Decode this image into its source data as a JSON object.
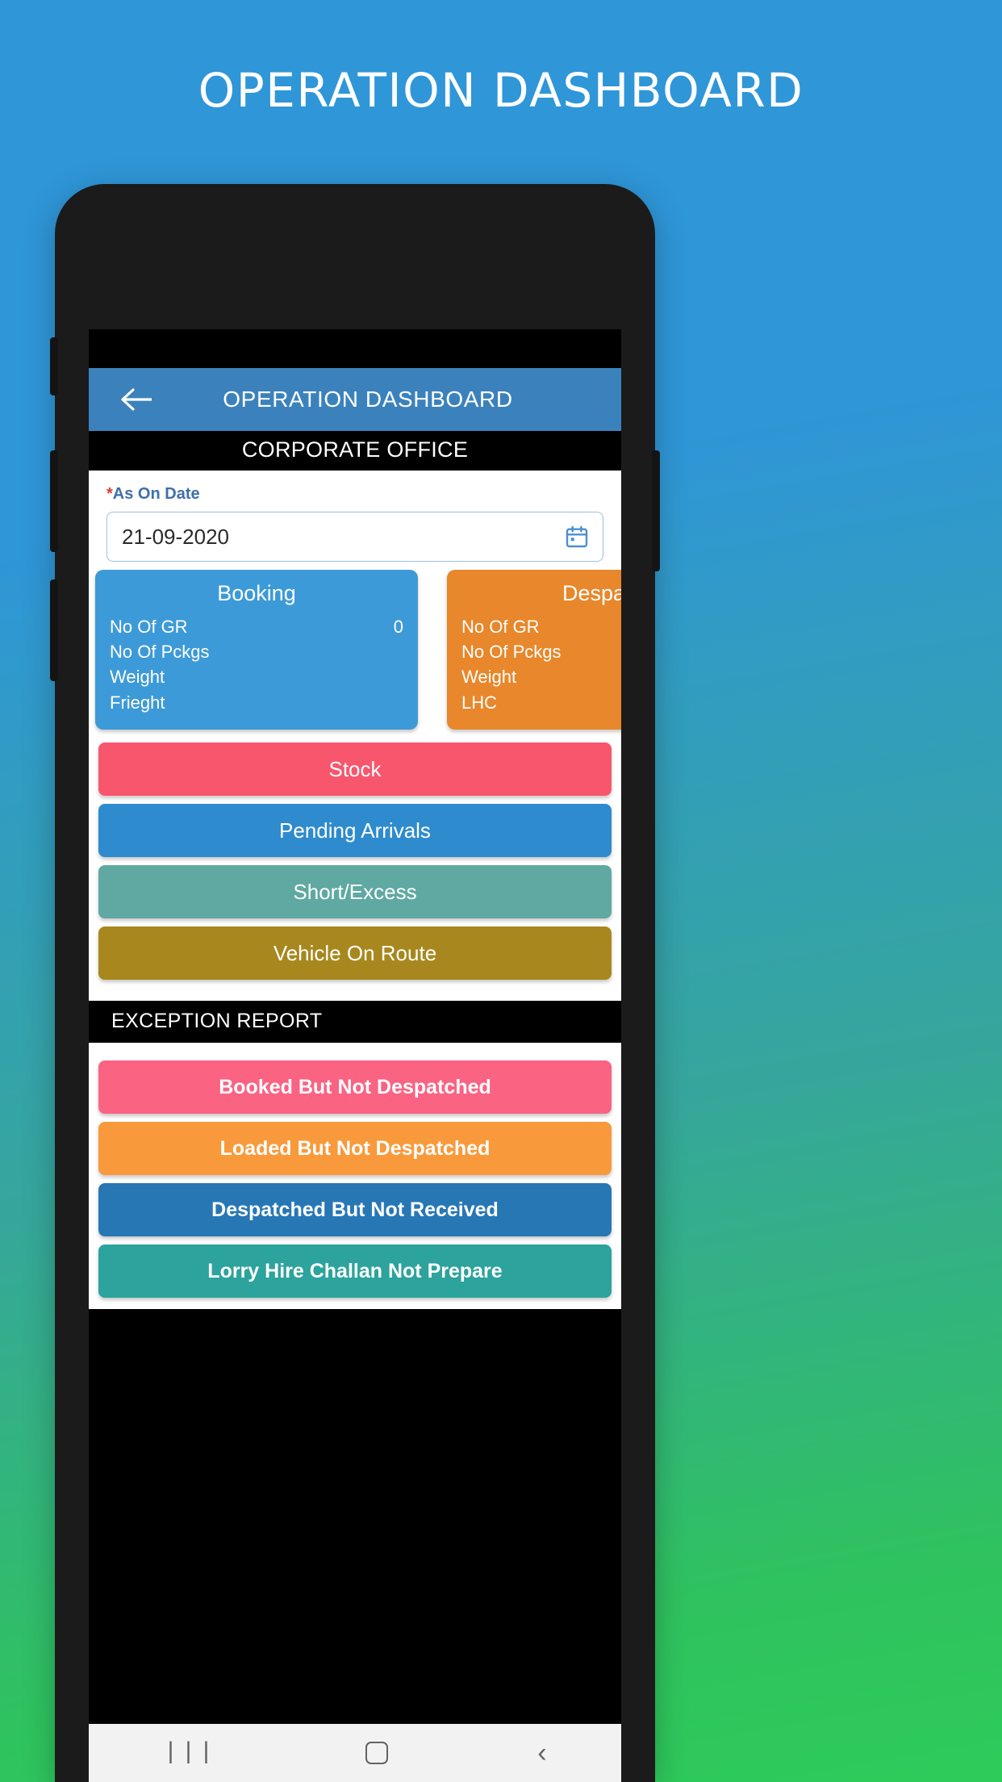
{
  "page": {
    "title": "OPERATION DASHBOARD"
  },
  "appbar": {
    "title": "OPERATION DASHBOARD",
    "back_icon": "arrow-left-icon"
  },
  "branch": {
    "label": "CORPORATE OFFICE"
  },
  "date_field": {
    "label": "As On Date",
    "required_mark": "*",
    "value": "21-09-2020",
    "icon": "calendar-icon"
  },
  "summary_cards": [
    {
      "title": "Booking",
      "color": "#3d9ad8",
      "rows": [
        {
          "label": "No Of GR",
          "value": "0"
        },
        {
          "label": "No Of Pckgs",
          "value": ""
        },
        {
          "label": "Weight",
          "value": ""
        },
        {
          "label": "Frieght",
          "value": ""
        }
      ]
    },
    {
      "title": "Despatch",
      "color": "#e8872b",
      "rows": [
        {
          "label": "No Of GR",
          "value": ""
        },
        {
          "label": "No Of Pckgs",
          "value": ""
        },
        {
          "label": "Weight",
          "value": ""
        },
        {
          "label": "LHC",
          "value": ""
        }
      ]
    }
  ],
  "actions": [
    {
      "label": "Stock",
      "color": "#f8566d"
    },
    {
      "label": "Pending Arrivals",
      "color": "#2e8bce"
    },
    {
      "label": "Short/Excess",
      "color": "#5fa9a2"
    },
    {
      "label": "Vehicle On Route",
      "color": "#a8881e"
    }
  ],
  "exception": {
    "header": "EXCEPTION REPORT",
    "items": [
      {
        "label": "Booked But Not Despatched",
        "color": "#fb6383"
      },
      {
        "label": "Loaded But Not Despatched",
        "color": "#f89a3c"
      },
      {
        "label": "Despatched But Not Received",
        "color": "#2877b5"
      },
      {
        "label": "Lorry Hire Challan Not Prepare",
        "color": "#2ca39c"
      }
    ]
  },
  "navbar": {
    "recents": "|||",
    "home_icon": "home-square-icon",
    "back": "‹"
  }
}
